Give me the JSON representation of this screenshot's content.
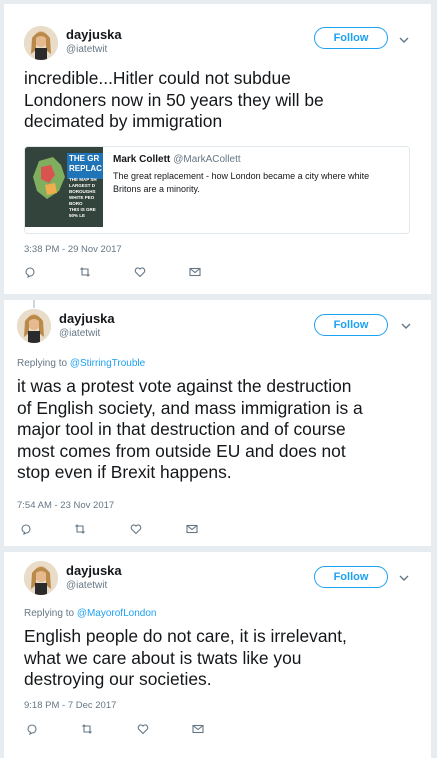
{
  "tweets": [
    {
      "name": "dayjuska",
      "handle": "@iatetwit",
      "follow_label": "Follow",
      "lines": [
        "incredible...Hitler could not subdue",
        "Londoners now in 50 years they will be",
        "decimated by immigration"
      ],
      "quote": {
        "name": "Mark Collett",
        "handle": "@MarkACollett",
        "lines": [
          "The great replacement - how London became a city where white",
          "Britons are a minority."
        ],
        "thumb_title": [
          "THE GR",
          "REPLAC"
        ],
        "thumb_lines": [
          "THE MAP SH",
          "LARGEST D",
          "BOROUGHS",
          "WHITE PEO",
          "BORO",
          "THIS IS GRE",
          "50% LE"
        ]
      },
      "timestamp": "3:38 PM - 29 Nov 2017",
      "actions": [
        "reply-icon",
        "retweet-icon",
        "like-icon",
        "message-icon"
      ]
    },
    {
      "name": "dayjuska",
      "handle": "@iatetwit",
      "follow_label": "Follow",
      "replying_prefix": "Replying to",
      "replying_to": "@StirringTrouble",
      "lines": [
        "it was a protest vote against the destruction",
        "of English society, and mass immigration is a",
        "major tool in that destruction and of course",
        "most comes from outside EU and does not",
        "stop even if Brexit happens."
      ],
      "timestamp": "7:54 AM - 23 Nov 2017",
      "actions": [
        "reply-icon",
        "retweet-icon",
        "like-icon",
        "message-icon"
      ]
    },
    {
      "name": "dayjuska",
      "handle": "@iatetwit",
      "follow_label": "Follow",
      "replying_prefix": "Replying to",
      "replying_to": "@MayorofLondon",
      "lines": [
        "English people do not care, it is irrelevant,",
        "what we care about is twats like you",
        "destroying our societies."
      ],
      "timestamp": "9:18 PM - 7 Dec 2017",
      "actions": [
        "reply-icon",
        "retweet-icon",
        "like-icon",
        "message-icon"
      ]
    }
  ],
  "colors": {
    "accent": "#1da1f2",
    "muted": "#657786",
    "text": "#14171a",
    "background": "#e6ecf0"
  }
}
